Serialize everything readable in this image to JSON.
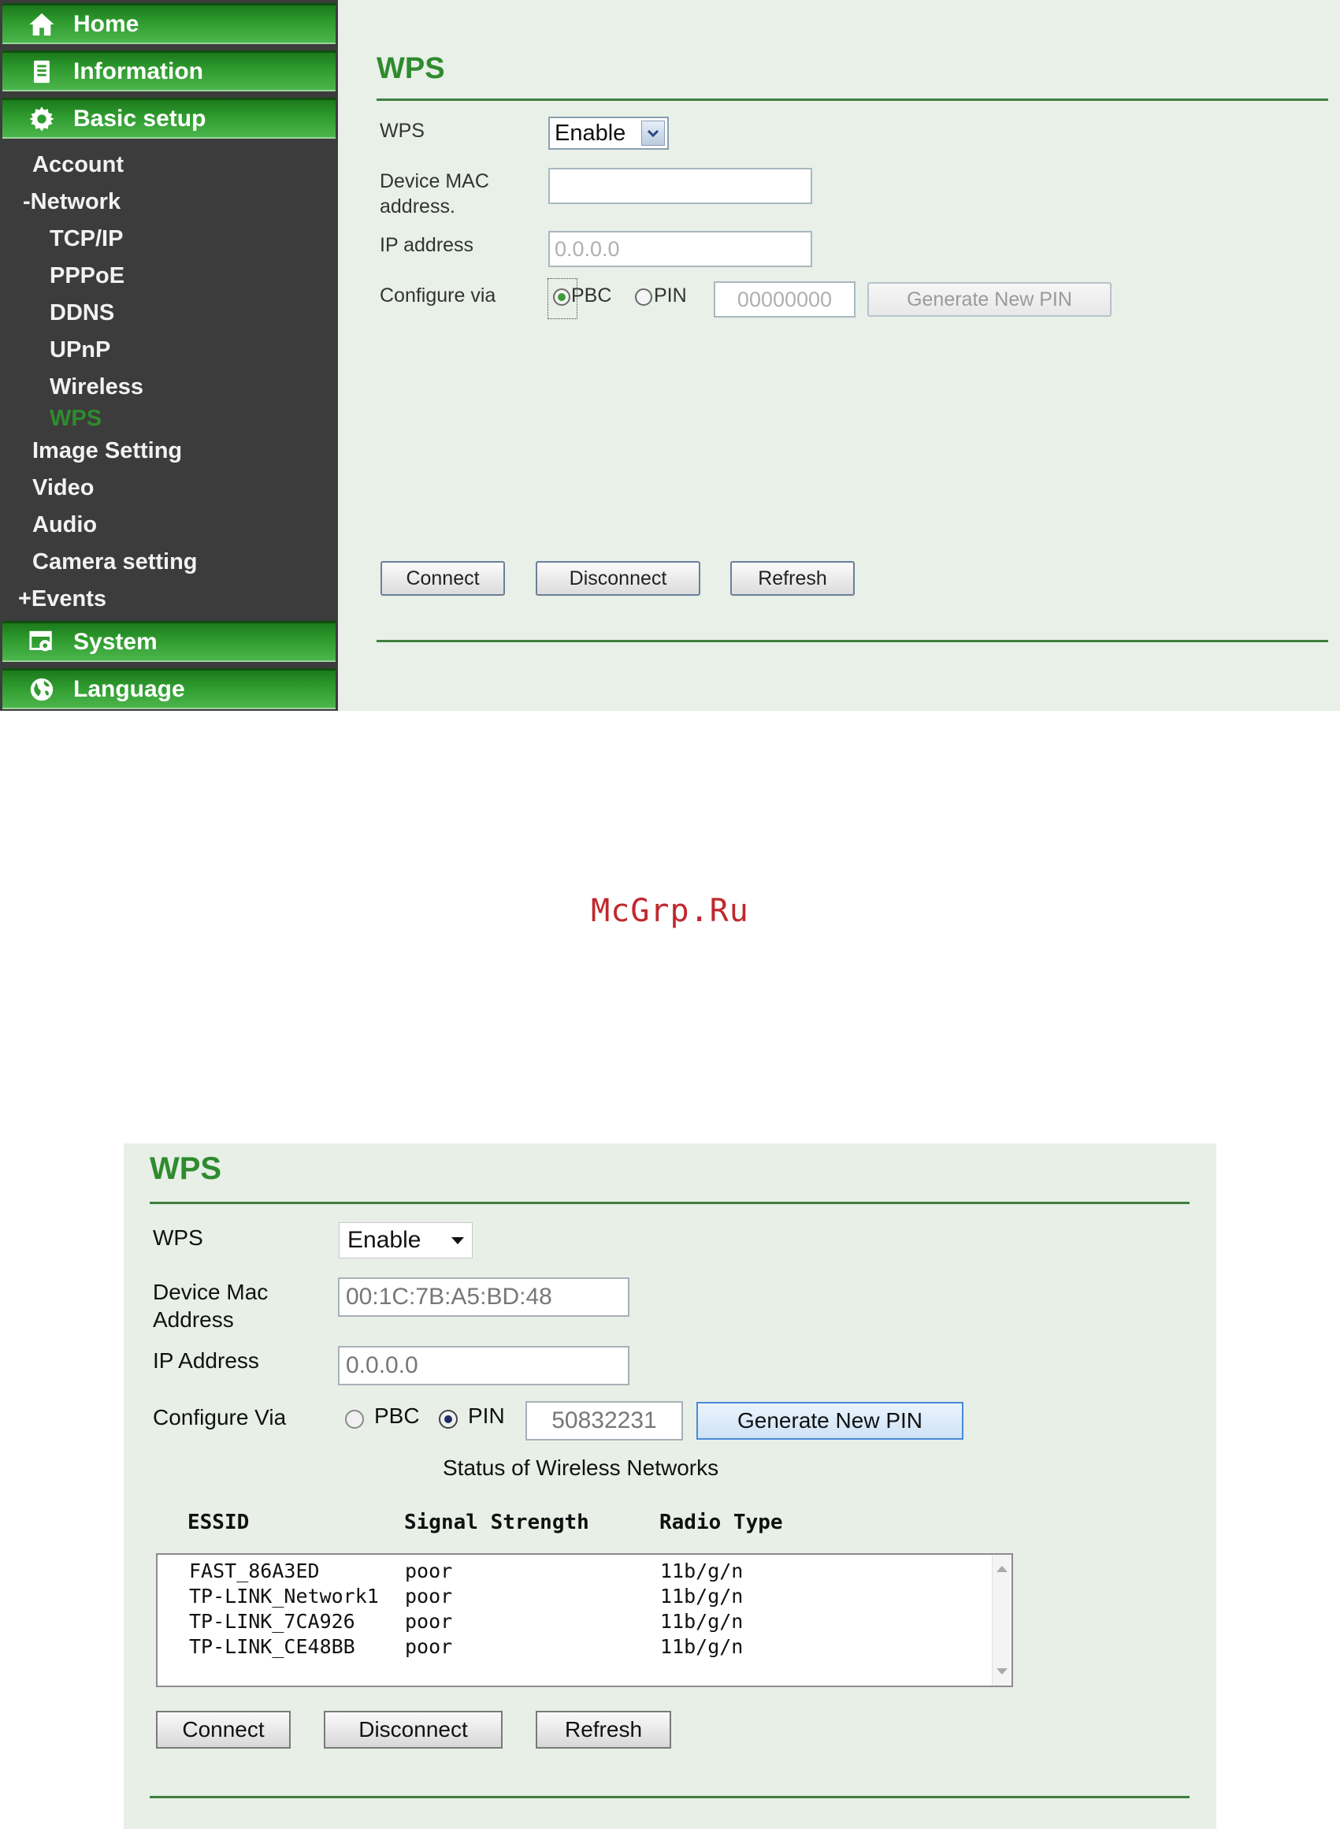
{
  "colors": {
    "accent_green": "#2e8b2e",
    "sidebar_bg": "#3c3c3c",
    "content_bg": "#e8f0e8",
    "watermark": "#c0282d"
  },
  "top": {
    "sidebar": {
      "main_items": [
        {
          "label": "Home",
          "icon": "home-icon"
        },
        {
          "label": "Information",
          "icon": "document-icon"
        },
        {
          "label": "Basic setup",
          "icon": "gear-icon"
        },
        {
          "label": "System",
          "icon": "system-icon"
        },
        {
          "label": "Language",
          "icon": "globe-icon"
        }
      ],
      "sub_items": {
        "account": "Account",
        "network": "-Network",
        "tcpip": "TCP/IP",
        "pppoe": "PPPoE",
        "ddns": "DDNS",
        "upnp": "UPnP",
        "wireless": "Wireless",
        "wps": "WPS",
        "image_setting": "Image Setting",
        "video": "Video",
        "audio": "Audio",
        "camera_setting": "Camera setting",
        "events": "+Events"
      }
    },
    "form": {
      "title": "WPS",
      "wps_label": "WPS",
      "wps_value": "Enable",
      "mac_label_1": "Device MAC",
      "mac_label_2": "address.",
      "mac_value": "",
      "ip_label": "IP address",
      "ip_value": "0.0.0.0",
      "configure_label": "Configure via",
      "pbc_label": "PBC",
      "pin_label": "PIN",
      "pin_value": "00000000",
      "generate_label": "Generate New PIN",
      "selected_mode": "PBC",
      "connect_label": "Connect",
      "disconnect_label": "Disconnect",
      "refresh_label": "Refresh"
    }
  },
  "watermark": "McGrp.Ru",
  "bottom": {
    "title": "WPS",
    "wps_label": "WPS",
    "wps_value": "Enable",
    "mac_label_1": "Device Mac",
    "mac_label_2": "Address",
    "mac_value": "00:1C:7B:A5:BD:48",
    "ip_label": "IP Address",
    "ip_value": "0.0.0.0",
    "configure_label": "Configure Via",
    "pbc_label": "PBC",
    "pin_label": "PIN",
    "pin_value": "50832231",
    "generate_label": "Generate New PIN",
    "selected_mode": "PIN",
    "status_title": "Status of Wireless Networks",
    "columns": [
      "ESSID",
      "Signal Strength",
      "Radio Type"
    ],
    "networks": [
      {
        "essid": "FAST_86A3ED",
        "signal": "poor",
        "radio": "11b/g/n"
      },
      {
        "essid": "TP-LINK_Network1",
        "signal": "poor",
        "radio": "11b/g/n"
      },
      {
        "essid": "TP-LINK_7CA926",
        "signal": "poor",
        "radio": "11b/g/n"
      },
      {
        "essid": "TP-LINK_CE48BB",
        "signal": "poor",
        "radio": "11b/g/n"
      }
    ],
    "connect_label": "Connect",
    "disconnect_label": "Disconnect",
    "refresh_label": "Refresh"
  }
}
